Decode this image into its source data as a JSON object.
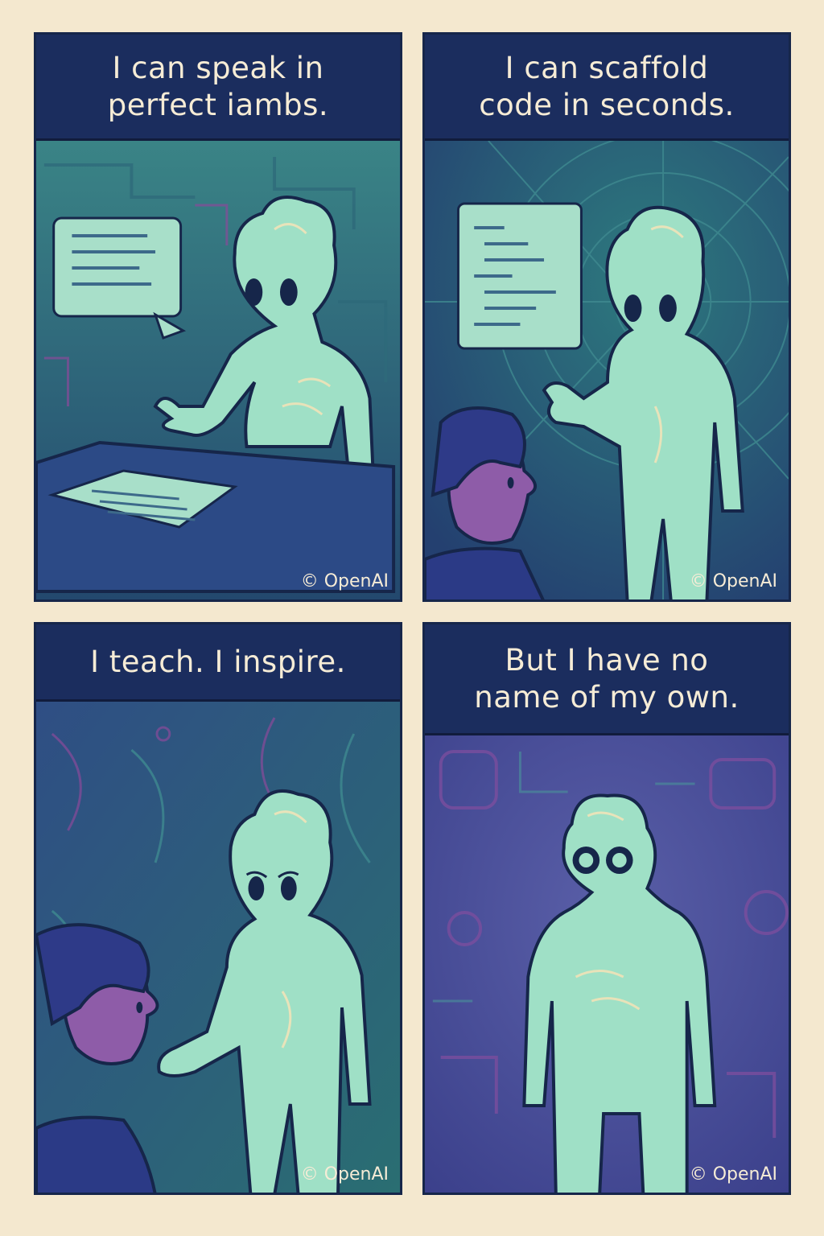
{
  "panels": [
    {
      "caption": "I can speak in\nperfect iambs.",
      "credit": "© OpenAI"
    },
    {
      "caption": "I can scaffold\ncode in seconds.",
      "credit": "© OpenAI"
    },
    {
      "caption": "I teach. I inspire.",
      "credit": "© OpenAI"
    },
    {
      "caption": "But I have no\nname of my own.",
      "credit": "© OpenAI"
    }
  ],
  "colors": {
    "page_background": "#f4e8cf",
    "caption_background": "#1b2d5e",
    "caption_text": "#f6ecd6",
    "figure_body": "#9fe0c6",
    "figure_outline": "#16264a",
    "human_skin": "#8e5ca8"
  }
}
